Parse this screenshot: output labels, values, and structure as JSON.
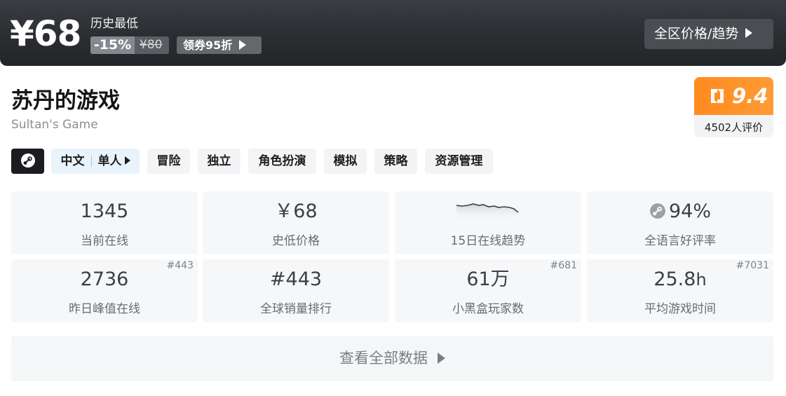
{
  "price_bar": {
    "current_price": "¥68",
    "label": "历史最低",
    "discount": "-15%",
    "original_price": "¥80",
    "coupon": "领券95折",
    "region_button": "全区价格/趋势"
  },
  "game": {
    "title": "苏丹的游戏",
    "subtitle": "Sultan's Game"
  },
  "score": {
    "value": "9.4",
    "count": "4502人评价",
    "accent_color": "#ff8a1f"
  },
  "tags": {
    "platform_icon": "steam-icon",
    "lang": "中文",
    "mode": "单人",
    "items": [
      "冒险",
      "独立",
      "角色扮演",
      "模拟",
      "策略",
      "资源管理"
    ]
  },
  "stats": {
    "current_online": {
      "value": "1345",
      "label": "当前在线"
    },
    "lowest_price": {
      "value": "￥68",
      "label": "史低价格"
    },
    "trend": {
      "label": "15日在线趋势",
      "icon": "sparkline-chart"
    },
    "rating": {
      "value": "94%",
      "label": "全语言好评率",
      "icon": "steam-icon"
    },
    "peak_yesterday": {
      "value": "2736",
      "label": "昨日峰值在线",
      "rank": "#443"
    },
    "global_sales": {
      "value": "#443",
      "label": "全球销量排行"
    },
    "xhh_players": {
      "value": "61万",
      "label": "小黑盒玩家数",
      "rank": "#681"
    },
    "avg_playtime": {
      "value": "25.8",
      "unit": "h",
      "label": "平均游戏时间",
      "rank": "#7031"
    }
  },
  "view_all": "查看全部数据"
}
